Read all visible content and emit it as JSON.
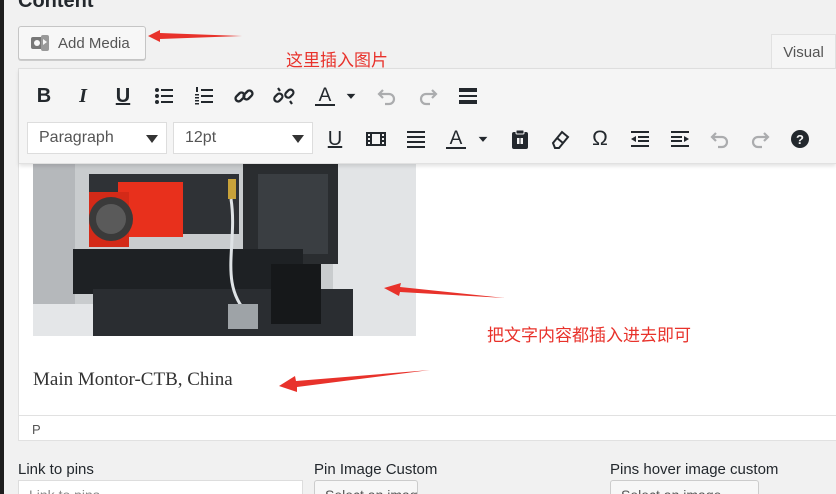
{
  "section": {
    "title": "Content"
  },
  "media": {
    "add_media_label": "Add Media"
  },
  "tabs": {
    "visual": "Visual"
  },
  "toolbar": {
    "format_select": "Paragraph",
    "fontsize_select": "12pt",
    "bold_letter": "B",
    "italic_letter": "I",
    "underline_letter": "U",
    "underline2_letter": "U",
    "textcolor_letter": "A",
    "bgcolor_letter": "A",
    "omega_letter": "Ω",
    "help_letter": "?"
  },
  "editor": {
    "caption": "Main Montor-CTB, China",
    "status_path": "P"
  },
  "annotations": {
    "insert_image": "这里插入图片",
    "insert_text": "把文字内容都插入进去即可"
  },
  "fields": {
    "link_to_pins_label": "Link to pins",
    "link_to_pins_placeholder": "Link to pins",
    "pin_image_custom_label": "Pin Image Custom",
    "pin_image_button": "Select an image",
    "pins_hover_label": "Pins hover image custom",
    "pins_hover_button": "Select an image"
  },
  "colors": {
    "annotation_red": "#e8322b",
    "motor_red": "#e8301c"
  }
}
